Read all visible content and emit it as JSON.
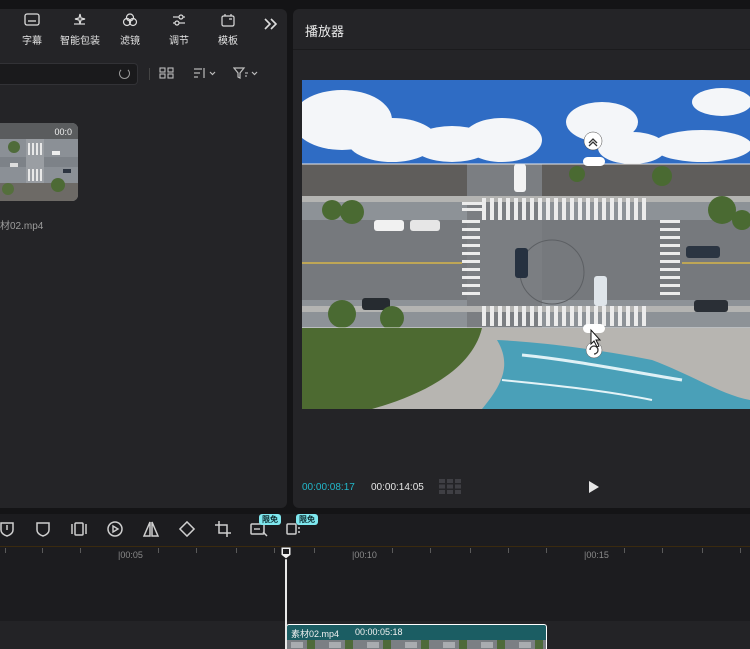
{
  "toolbar": {
    "items": [
      {
        "label": "字幕",
        "icon": "subtitle-icon"
      },
      {
        "label": "智能包装",
        "icon": "sparkle-icon"
      },
      {
        "label": "滤镜",
        "icon": "filter-icon"
      },
      {
        "label": "调节",
        "icon": "adjust-icon"
      },
      {
        "label": "模板",
        "icon": "template-icon"
      }
    ],
    "more_icon": "double-chevron-right-icon"
  },
  "media": {
    "file_name": "材02.mp4",
    "thumb_duration": "00:0"
  },
  "player": {
    "title": "播放器",
    "current_time": "00:00:08:17",
    "total_time": "00:00:14:05"
  },
  "edit_tools": {
    "badges": [
      "限免",
      "限免"
    ]
  },
  "timeline": {
    "ticks": [
      "|00:05",
      "|00:10",
      "|00:15"
    ],
    "clip_name": "素材02.mp4",
    "clip_duration": "00:00:05:18"
  },
  "colors": {
    "accent": "#22b7c9",
    "badge": "#7fe8ef",
    "clip": "#1b5d63"
  }
}
